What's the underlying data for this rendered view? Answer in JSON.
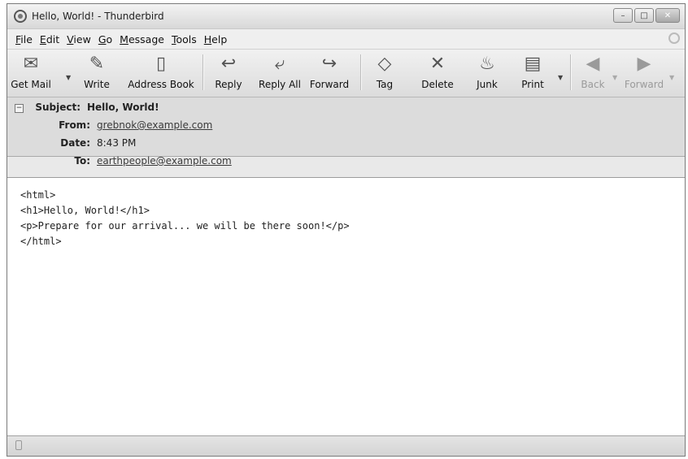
{
  "window": {
    "title": "Hello, World! - Thunderbird",
    "controls": {
      "minimize": "–",
      "maximize": "□",
      "close": "✕"
    }
  },
  "menubar": {
    "items": [
      {
        "label": "File",
        "underline": "F",
        "rest": "ile"
      },
      {
        "label": "Edit",
        "underline": "E",
        "rest": "dit"
      },
      {
        "label": "View",
        "underline": "V",
        "rest": "iew"
      },
      {
        "label": "Go",
        "underline": "G",
        "rest": "o"
      },
      {
        "label": "Message",
        "underline": "M",
        "rest": "essage"
      },
      {
        "label": "Tools",
        "underline": "T",
        "rest": "ools"
      },
      {
        "label": "Help",
        "underline": "H",
        "rest": "elp"
      }
    ]
  },
  "toolbar": {
    "get_mail": "Get Mail",
    "write": "Write",
    "address_book": "Address Book",
    "reply": "Reply",
    "reply_all": "Reply All",
    "forward": "Forward",
    "tag": "Tag",
    "delete": "Delete",
    "junk": "Junk",
    "print": "Print",
    "back": "Back",
    "forward_nav": "Forward",
    "icons": {
      "get_mail": "get-mail-icon",
      "write": "pencil-icon",
      "address_book": "address-book-icon",
      "reply": "reply-icon",
      "reply_all": "reply-all-icon",
      "forward": "forward-icon",
      "tag": "tag-icon",
      "delete": "delete-x-icon",
      "junk": "junk-flame-icon",
      "print": "printer-icon",
      "back": "back-arrow-icon",
      "forward_nav": "forward-arrow-icon"
    }
  },
  "header": {
    "subject_label": "Subject:",
    "subject_value": "Hello, World!",
    "from_label": "From:",
    "from_value": "grebnok@example.com",
    "date_label": "Date:",
    "date_value": "8:43 PM",
    "to_label": "To:",
    "to_value": "earthpeople@example.com"
  },
  "body": {
    "lines": [
      "<html>",
      "<h1>Hello, World!</h1>",
      "<p>Prepare for our arrival... we will be there soon!</p>",
      "</html>"
    ]
  },
  "colors": {
    "window_bg": "#e9e9e9",
    "header_bg": "#dcdcdc",
    "body_bg": "#ffffff"
  }
}
